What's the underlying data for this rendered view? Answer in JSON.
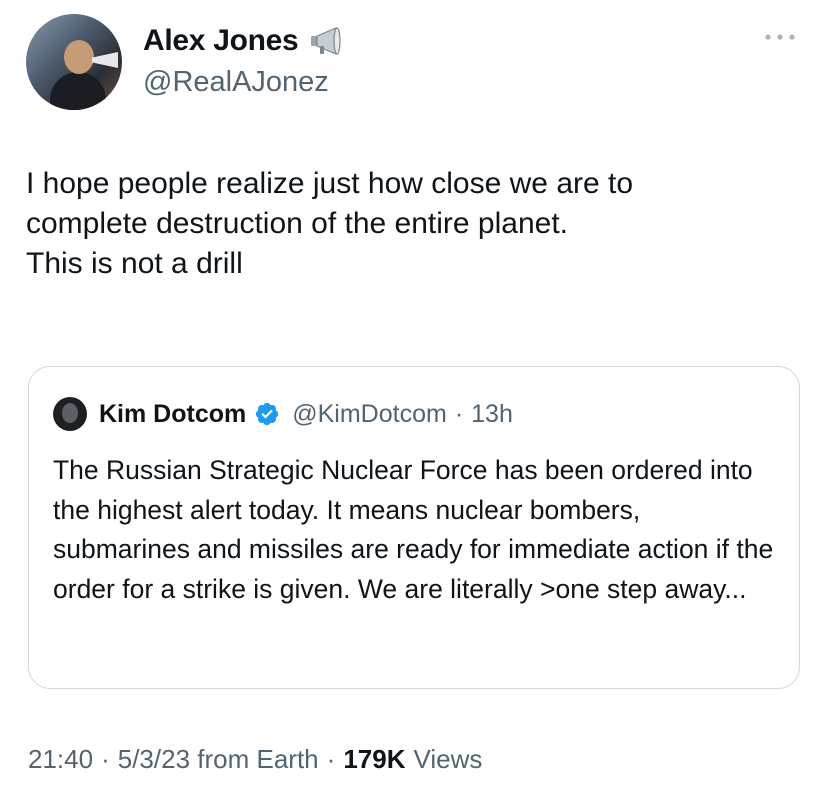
{
  "author": {
    "display_name": "Alex Jones",
    "handle": "@RealAJonez",
    "name_icon": "megaphone-icon"
  },
  "tweet": {
    "text": "I hope people realize just how close we are to\ncomplete destruction of the entire planet.\nThis is not a drill"
  },
  "quote": {
    "display_name": "Kim Dotcom",
    "verified_icon": "verified-badge-icon",
    "handle": "@KimDotcom",
    "separator": "·",
    "time": "13h",
    "text": "The Russian Strategic Nuclear Force has been ordered into the highest alert today. It means nuclear bombers, submarines and missiles are ready for immediate action if the order for a strike is given. We are literally >one step away..."
  },
  "meta": {
    "time": "21:40",
    "sep1": "·",
    "date_source": "5/3/23 from Earth",
    "sep2": "·",
    "views_count": "179K",
    "views_label": "Views"
  },
  "colors": {
    "text": "#0f1419",
    "secondary": "#536471",
    "border": "#cfd9de",
    "verified": "#1d9bf0"
  }
}
